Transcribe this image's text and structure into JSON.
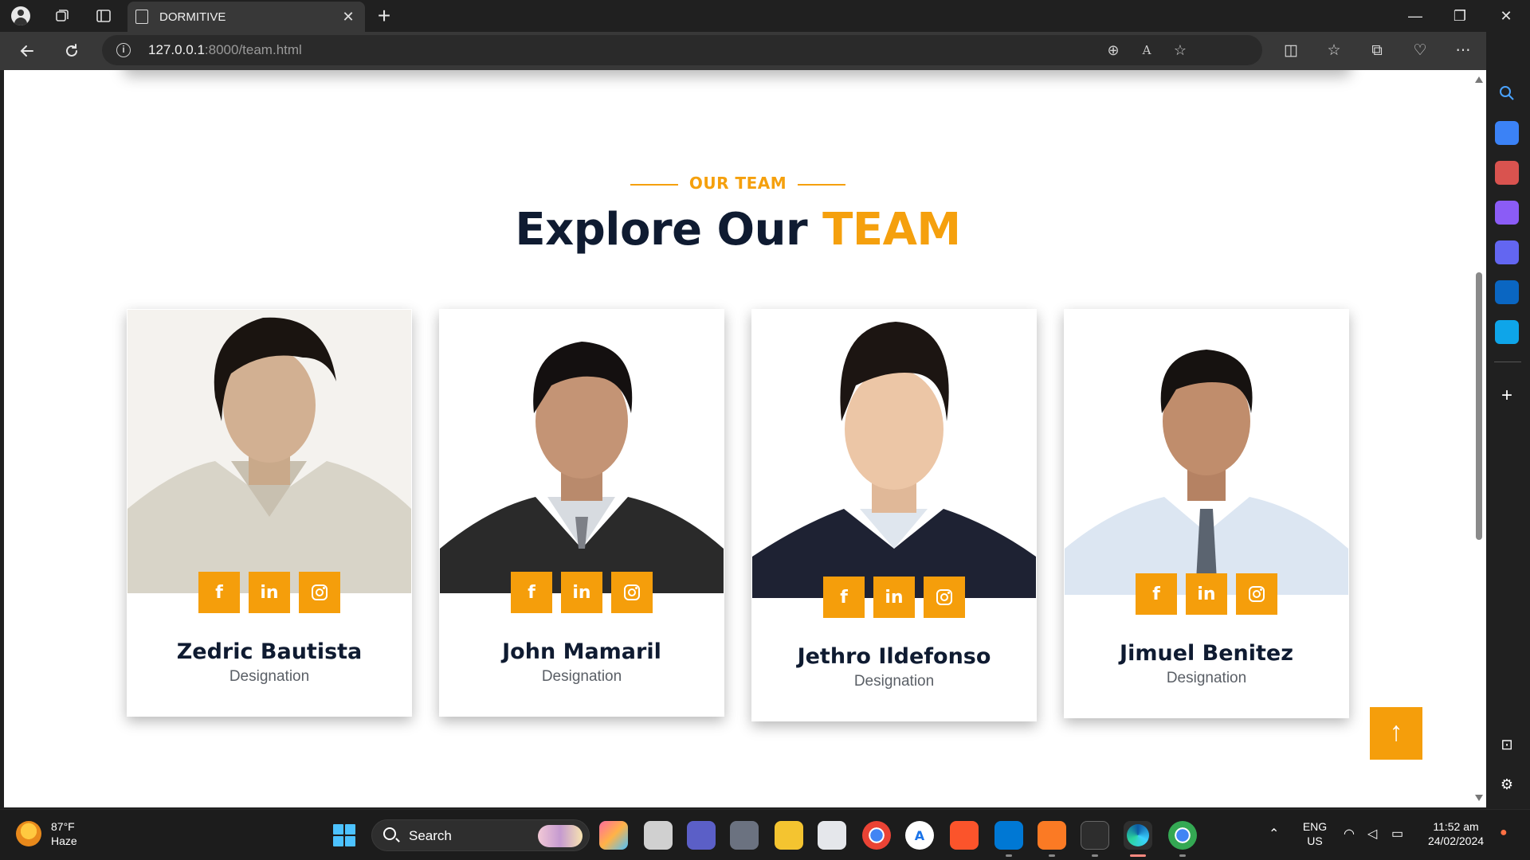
{
  "browser": {
    "tab_title": "DORMITIVE",
    "tab_close": "✕",
    "new_tab": "+",
    "url_host": "127.0.0.1",
    "url_rest": ":8000/team.html",
    "window_minimize": "—",
    "window_maximize": "❐",
    "window_close": "✕"
  },
  "page": {
    "kicker": "OUR TEAM",
    "title_main": "Explore Our",
    "title_accent": "TEAM",
    "back_to_top": "↑"
  },
  "team": [
    {
      "name": "Zedric Bautista",
      "role": "Designation",
      "icons": [
        "f",
        "in",
        "ig"
      ]
    },
    {
      "name": "John Mamaril",
      "role": "Designation",
      "icons": [
        "f",
        "in",
        "ig"
      ]
    },
    {
      "name": "Jethro Ildefonso",
      "role": "Designation",
      "icons": [
        "f",
        "in",
        "ig"
      ]
    },
    {
      "name": "Jimuel Benitez",
      "role": "Designation",
      "icons": [
        "f",
        "in",
        "ig"
      ]
    }
  ],
  "social_labels": {
    "facebook": "f",
    "linkedin": "in"
  },
  "taskbar": {
    "temperature": "87°F",
    "condition": "Haze",
    "search_label": "Search",
    "lang_1": "ENG",
    "lang_2": "US",
    "time": "11:52 am",
    "date": "24/02/2024"
  },
  "colors": {
    "accent": "#f59e0b",
    "navy": "#0f1b31"
  }
}
